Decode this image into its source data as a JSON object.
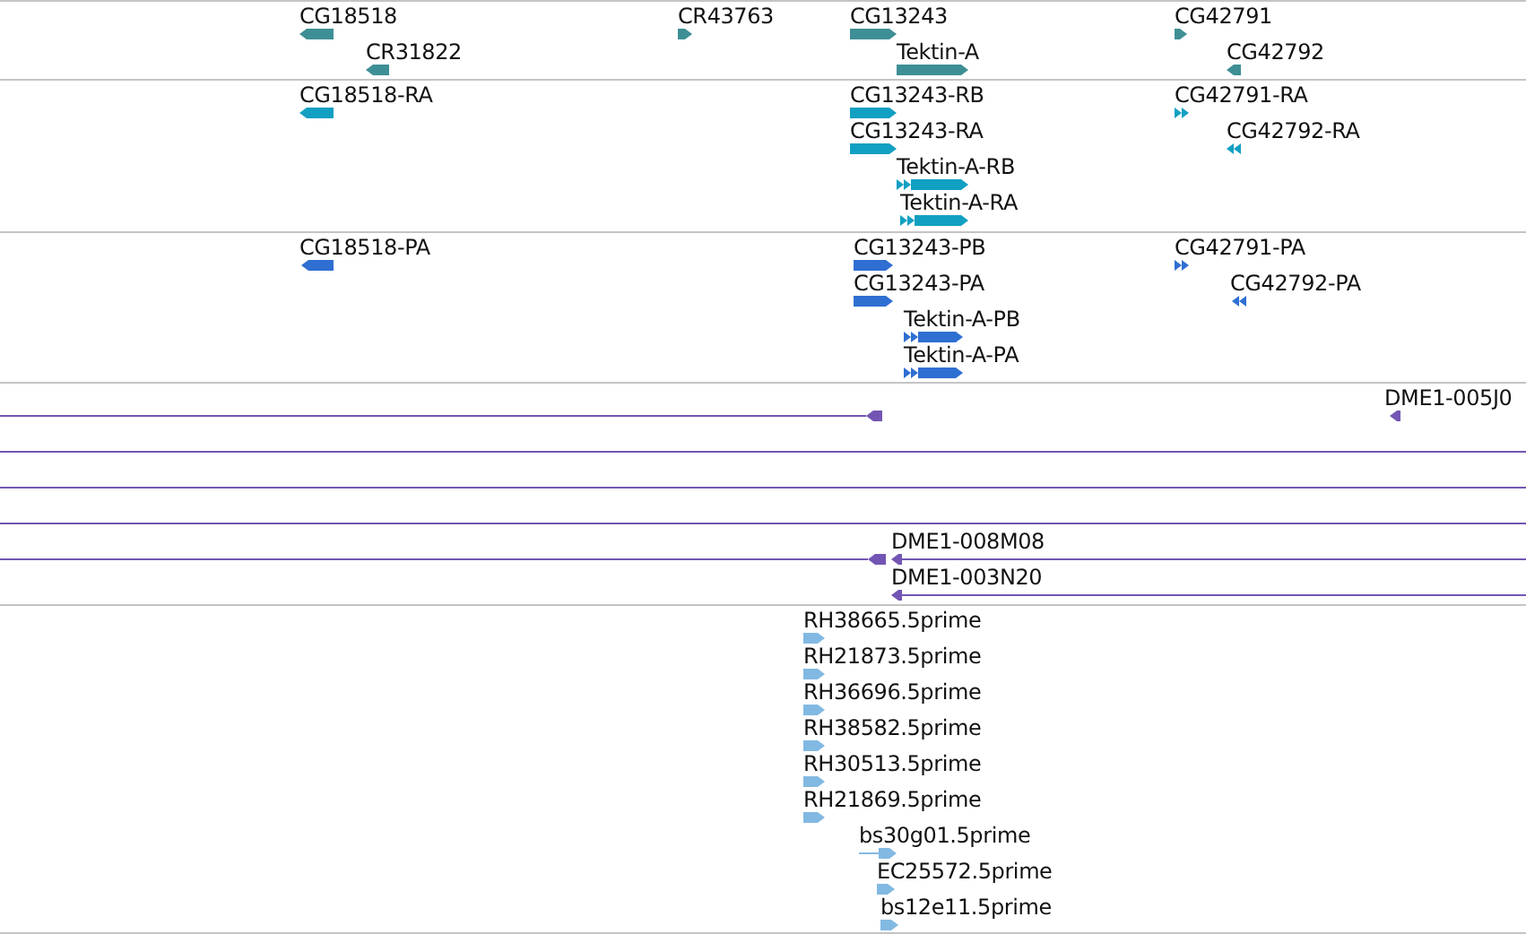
{
  "tracks": [
    {
      "color": "#3e8f95",
      "features": [
        {
          "kind": "arrow",
          "label": "CG18518",
          "reverse": true
        },
        {
          "kind": "arrow",
          "label": "CR31822",
          "reverse": true
        },
        {
          "kind": "arrow",
          "label": "CR43763",
          "reverse": false
        },
        {
          "kind": "arrow",
          "label": "CG13243",
          "reverse": false
        },
        {
          "kind": "arrow",
          "label": "Tektin-A",
          "reverse": false
        },
        {
          "kind": "arrow",
          "label": "CG42791",
          "reverse": false
        },
        {
          "kind": "arrow",
          "label": "CG42792",
          "reverse": true
        }
      ]
    },
    {
      "color": "#12a0c2",
      "features": [
        {
          "kind": "arrow",
          "label": "CG18518-RA",
          "reverse": true
        },
        {
          "kind": "arrow",
          "label": "CG13243-RB",
          "reverse": false
        },
        {
          "kind": "arrow",
          "label": "CG13243-RA",
          "reverse": false
        },
        {
          "kind": "arrow",
          "label": "Tektin-A-RB",
          "reverse": false
        },
        {
          "kind": "arrow",
          "label": "Tektin-A-RA",
          "reverse": false
        },
        {
          "kind": "arrow",
          "label": "CG42791-RA",
          "reverse": false
        },
        {
          "kind": "arrow",
          "label": "CG42792-RA",
          "reverse": true
        }
      ]
    },
    {
      "color": "#2f6fd2",
      "features": [
        {
          "kind": "arrow",
          "label": "CG18518-PA",
          "reverse": true
        },
        {
          "kind": "arrow",
          "label": "CG13243-PB",
          "reverse": false
        },
        {
          "kind": "arrow",
          "label": "CG13243-PA",
          "reverse": false
        },
        {
          "kind": "arrow",
          "label": "Tektin-A-PB",
          "reverse": false
        },
        {
          "kind": "arrow",
          "label": "Tektin-A-PA",
          "reverse": false
        },
        {
          "kind": "arrow",
          "label": "CG42791-PA",
          "reverse": false
        },
        {
          "kind": "arrow",
          "label": "CG42792-PA",
          "reverse": true
        }
      ]
    },
    {
      "color": "#7355b3",
      "features": [
        {
          "kind": "arrow",
          "reverse": true
        },
        {
          "kind": "arrow",
          "label": "DME1-005J0",
          "reverse": true
        },
        {
          "kind": "line"
        },
        {
          "kind": "line"
        },
        {
          "kind": "line"
        },
        {
          "kind": "arrow",
          "reverse": true
        },
        {
          "kind": "arrow",
          "label": "DME1-008M08",
          "reverse": true
        },
        {
          "kind": "arrow",
          "label": "DME1-003N20",
          "reverse": true
        }
      ]
    },
    {
      "color": "#82b9e2",
      "features": [
        {
          "kind": "arrow",
          "label": "RH38665.5prime",
          "reverse": false
        },
        {
          "kind": "arrow",
          "label": "RH21873.5prime",
          "reverse": false
        },
        {
          "kind": "arrow",
          "label": "RH36696.5prime",
          "reverse": false
        },
        {
          "kind": "arrow",
          "label": "RH38582.5prime",
          "reverse": false
        },
        {
          "kind": "arrow",
          "label": "RH30513.5prime",
          "reverse": false
        },
        {
          "kind": "arrow",
          "label": "RH21869.5prime",
          "reverse": false
        },
        {
          "kind": "arrow",
          "label": "bs30g01.5prime",
          "reverse": false
        },
        {
          "kind": "arrow",
          "label": "EC25572.5prime",
          "reverse": false
        },
        {
          "kind": "arrow",
          "label": "bs12e11.5prime",
          "reverse": false
        }
      ]
    }
  ]
}
